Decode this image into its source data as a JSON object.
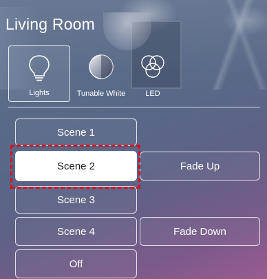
{
  "room": {
    "title": "Living Room"
  },
  "modes": [
    {
      "label": "Lights",
      "icon": "lightbulb-icon",
      "selected": true
    },
    {
      "label": "Tunable White",
      "icon": "tunable-white-icon",
      "selected": false
    },
    {
      "label": "LED",
      "icon": "rgb-circles-icon",
      "selected": false
    }
  ],
  "scenes": {
    "scene1": "Scene 1",
    "scene2": "Scene 2",
    "scene3": "Scene 3",
    "scene4": "Scene 4",
    "off": "Off",
    "fade_up": "Fade Up",
    "fade_down": "Fade Down",
    "active": "Scene 2"
  },
  "colors": {
    "highlight": "#d4141c",
    "active_bg": "#ffffff",
    "active_text": "#1c1c1c"
  }
}
